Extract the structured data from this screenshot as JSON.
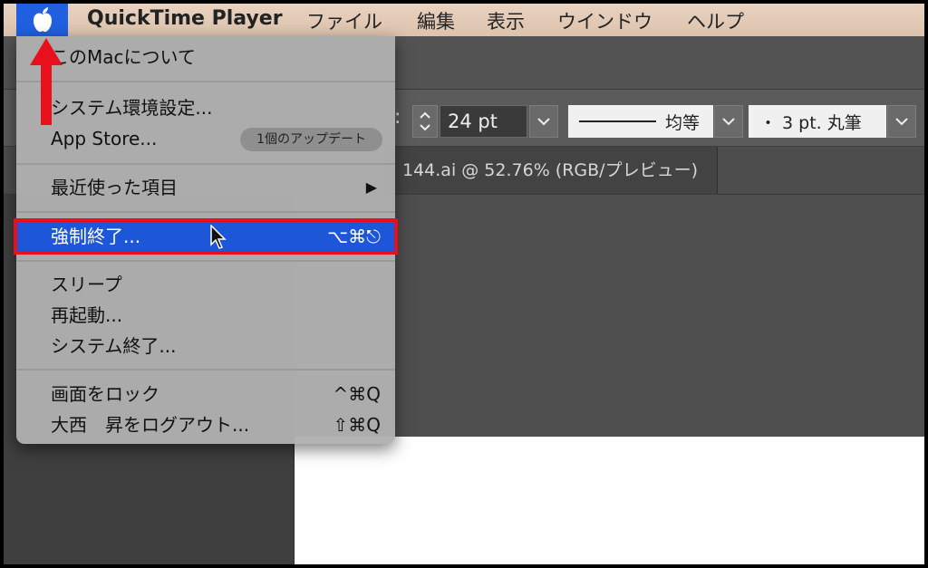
{
  "menubar": {
    "app_name": "QuickTime Player",
    "items": [
      "ファイル",
      "編集",
      "表示",
      "ウインドウ",
      "ヘルプ"
    ]
  },
  "apple_menu": {
    "about": "このMacについて",
    "system_prefs": "システム環境設定...",
    "app_store": "App Store...",
    "update_badge": "1個のアップデート",
    "recent_items": "最近使った項目",
    "force_quit": "強制終了...",
    "force_quit_shortcut": "⌥⌘⎋",
    "sleep": "スリープ",
    "restart": "再起動...",
    "shutdown": "システム終了...",
    "lock_screen": "画面をロック",
    "lock_screen_shortcut": "^⌘Q",
    "logout": "大西　昇をログアウト...",
    "logout_shortcut": "⇧⌘Q"
  },
  "toolbar": {
    "font_size": "24 pt",
    "stroke_profile": "均等",
    "brush": "・ 3 pt. 丸筆"
  },
  "document": {
    "tab_title": "144.ai @ 52.76% (RGB/プレビュー)"
  },
  "colors": {
    "highlight": "#1d56d8",
    "annotation_red": "#e8101d"
  }
}
